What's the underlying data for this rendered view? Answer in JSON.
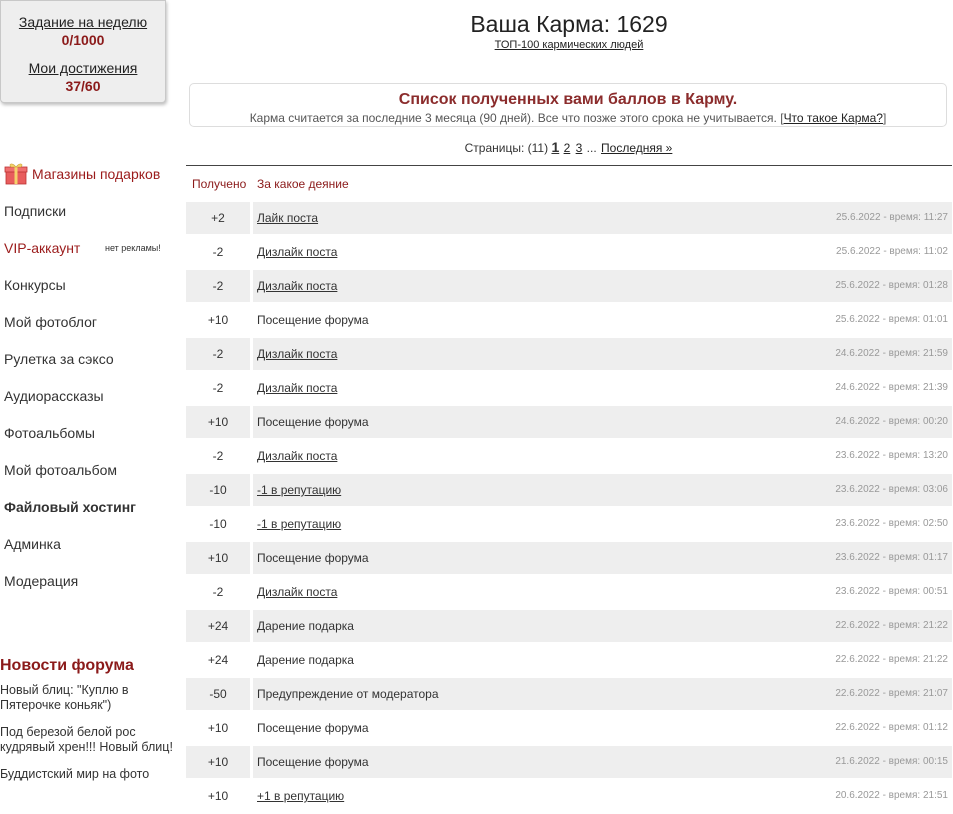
{
  "tasks": {
    "weekly_label": "Задание на неделю",
    "weekly_value": "0/1000",
    "achievements_label": "Мои достижения",
    "achievements_value": "37/60"
  },
  "sidebar": {
    "items": [
      {
        "label": "Магазины подарков",
        "icon": "gift-icon"
      },
      {
        "label": "Подписки"
      },
      {
        "label": "VIP-аккаунт",
        "note": "нет рекламы!"
      },
      {
        "label": "Конкурсы"
      },
      {
        "label": "Мой фотоблог"
      },
      {
        "label": "Рулетка за сэксо"
      },
      {
        "label": "Аудиорассказы"
      },
      {
        "label": "Фотоальбомы"
      },
      {
        "label": "Мой фотоальбом"
      },
      {
        "label": "Файловый хостинг"
      },
      {
        "label": "Админка"
      },
      {
        "label": "Модерация"
      }
    ]
  },
  "news": {
    "title": "Новости форума",
    "items": [
      "Новый блиц: \"Куплю в Пятерочке коньяк\")",
      "Под березой белой рос кудрявый хрен!!! Новый блиц!",
      "Буддистский мир на фото"
    ]
  },
  "header": {
    "title": "Ваша Карма: 1629",
    "top_link": "ТОП-100 кармических людей"
  },
  "info": {
    "heading": "Список полученных вами баллов в Карму.",
    "text": "Карма считается за последние 3 месяца (90 дней). Все что позже этого срока не учитывается. [",
    "link": "Что такое Карма?",
    "close": "]"
  },
  "pagination": {
    "prefix": "Страницы: (11)",
    "current": "1",
    "p2": "2",
    "p3": "3",
    "ellipsis": "...",
    "last": "Последняя »"
  },
  "table": {
    "col_received": "Получено",
    "col_deed": "За какое деяние",
    "rows": [
      {
        "points": "+2",
        "deed": "Лайк поста",
        "link": true,
        "time": "25.6.2022 - время: 11:27"
      },
      {
        "points": "-2",
        "deed": "Дизлайк поста",
        "link": true,
        "time": "25.6.2022 - время: 11:02"
      },
      {
        "points": "-2",
        "deed": "Дизлайк поста",
        "link": true,
        "time": "25.6.2022 - время: 01:28"
      },
      {
        "points": "+10",
        "deed": "Посещение форума",
        "link": false,
        "time": "25.6.2022 - время: 01:01"
      },
      {
        "points": "-2",
        "deed": "Дизлайк поста",
        "link": true,
        "time": "24.6.2022 - время: 21:59"
      },
      {
        "points": "-2",
        "deed": "Дизлайк поста",
        "link": true,
        "time": "24.6.2022 - время: 21:39"
      },
      {
        "points": "+10",
        "deed": "Посещение форума",
        "link": false,
        "time": "24.6.2022 - время: 00:20"
      },
      {
        "points": "-2",
        "deed": "Дизлайк поста",
        "link": true,
        "time": "23.6.2022 - время: 13:20"
      },
      {
        "points": "-10",
        "deed": "-1 в репутацию",
        "link": true,
        "time": "23.6.2022 - время: 03:06"
      },
      {
        "points": "-10",
        "deed": "-1 в репутацию",
        "link": true,
        "time": "23.6.2022 - время: 02:50"
      },
      {
        "points": "+10",
        "deed": "Посещение форума",
        "link": false,
        "time": "23.6.2022 - время: 01:17"
      },
      {
        "points": "-2",
        "deed": "Дизлайк поста",
        "link": true,
        "time": "23.6.2022 - время: 00:51"
      },
      {
        "points": "+24",
        "deed": "Дарение подарка",
        "link": false,
        "time": "22.6.2022 - время: 21:22"
      },
      {
        "points": "+24",
        "deed": "Дарение подарка",
        "link": false,
        "time": "22.6.2022 - время: 21:22"
      },
      {
        "points": "-50",
        "deed": "Предупреждение от модератора",
        "link": false,
        "time": "22.6.2022 - время: 21:07"
      },
      {
        "points": "+10",
        "deed": "Посещение форума",
        "link": false,
        "time": "22.6.2022 - время: 01:12"
      },
      {
        "points": "+10",
        "deed": "Посещение форума",
        "link": false,
        "time": "21.6.2022 - время: 00:15"
      },
      {
        "points": "+10",
        "deed": "+1 в репутацию",
        "link": true,
        "time": "20.6.2022 - время: 21:51"
      }
    ]
  }
}
